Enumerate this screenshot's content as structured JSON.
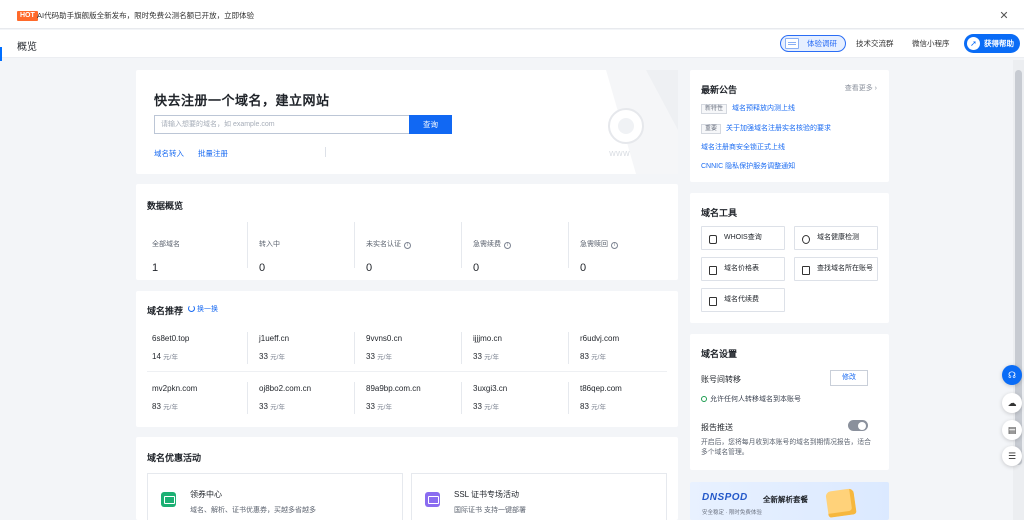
{
  "banner": {
    "hot": "HOT",
    "text": "AI代码助手旗舰版全新发布，限时免费公测名额已开放，立即体验",
    "close_icon": "close-icon"
  },
  "header": {
    "title": "概览",
    "survey_label": "体验调研",
    "tech_group": "技术交流群",
    "mini_program": "微信小程序",
    "help_label": "获得帮助"
  },
  "register": {
    "title": "快去注册一个域名，建立网站",
    "placeholder": "请输入想要的域名，如 example.com",
    "search_label": "查询",
    "transfer_link": "域名转入",
    "bulk_link": "批量注册"
  },
  "overview": {
    "title": "数据概览",
    "stats": [
      {
        "label": "全部域名",
        "value": "1"
      },
      {
        "label": "转入中",
        "value": "0"
      },
      {
        "label": "未实名认证",
        "value": "0"
      },
      {
        "label": "急需续费",
        "value": "0"
      },
      {
        "label": "急需赎回",
        "value": "0"
      }
    ],
    "info_icon": "i"
  },
  "recommend": {
    "title": "域名推荐",
    "refresh_label": "换一换",
    "unit": "元/年",
    "items": [
      {
        "name": "6s8et0.top",
        "price": "14"
      },
      {
        "name": "j1ueff.cn",
        "price": "33"
      },
      {
        "name": "9vvns0.cn",
        "price": "33"
      },
      {
        "name": "ijjjmo.cn",
        "price": "33"
      },
      {
        "name": "r6udvj.com",
        "price": "83"
      },
      {
        "name": "mv2pkn.com",
        "price": "83"
      },
      {
        "name": "oj8bo2.com.cn",
        "price": "33"
      },
      {
        "name": "89a9bp.com.cn",
        "price": "33"
      },
      {
        "name": "3uxgi3.cn",
        "price": "33"
      },
      {
        "name": "t86qep.com",
        "price": "83"
      }
    ]
  },
  "promotions": {
    "title": "域名优惠活动",
    "items": [
      {
        "title": "领券中心",
        "desc": "域名、解析、证书优惠券，买越多省越多",
        "color": "#1bb073"
      },
      {
        "title": "SSL 证书专场活动",
        "desc": "国际证书 支持一键部署",
        "color": "#8a6cf0"
      }
    ]
  },
  "announcements": {
    "title": "最新公告",
    "more": "查看更多 ›",
    "items": [
      {
        "tag": "新特性",
        "text": "域名预释放内测上线"
      },
      {
        "tag": "重要",
        "text": "关于加强域名注册实名核验的要求"
      },
      {
        "tag": "",
        "text": "域名注册商安全锁正式上线"
      },
      {
        "tag": "",
        "text": "CNNIC 隐私保护服务调整通知"
      }
    ]
  },
  "tools": {
    "title": "域名工具",
    "items": [
      {
        "label": "WHOIS查询",
        "icon": "search-icon"
      },
      {
        "label": "域名健康检测",
        "icon": "health-check-icon"
      },
      {
        "label": "域名价格表",
        "icon": "price-list-icon"
      },
      {
        "label": "查找域名所在账号",
        "icon": "find-account-icon"
      },
      {
        "label": "域名代续费",
        "icon": "renew-icon"
      }
    ]
  },
  "settings": {
    "title": "域名设置",
    "transfer_title": "账号间转移",
    "edit_label": "修改",
    "transfer_note": "允许任何人转移域名到本账号",
    "report_title": "报告推送",
    "report_enabled": false,
    "report_desc": "开启后，您将每月收到本账号的域名到期情况报告，适合多个域名管理。"
  },
  "dnspod": {
    "logo": "DNSPOD",
    "title": "全新解析套餐",
    "sub": "安全稳定 · 限时免费体验"
  },
  "float_tools": [
    "headset-icon",
    "cloud-icon",
    "book-icon",
    "list-icon"
  ]
}
